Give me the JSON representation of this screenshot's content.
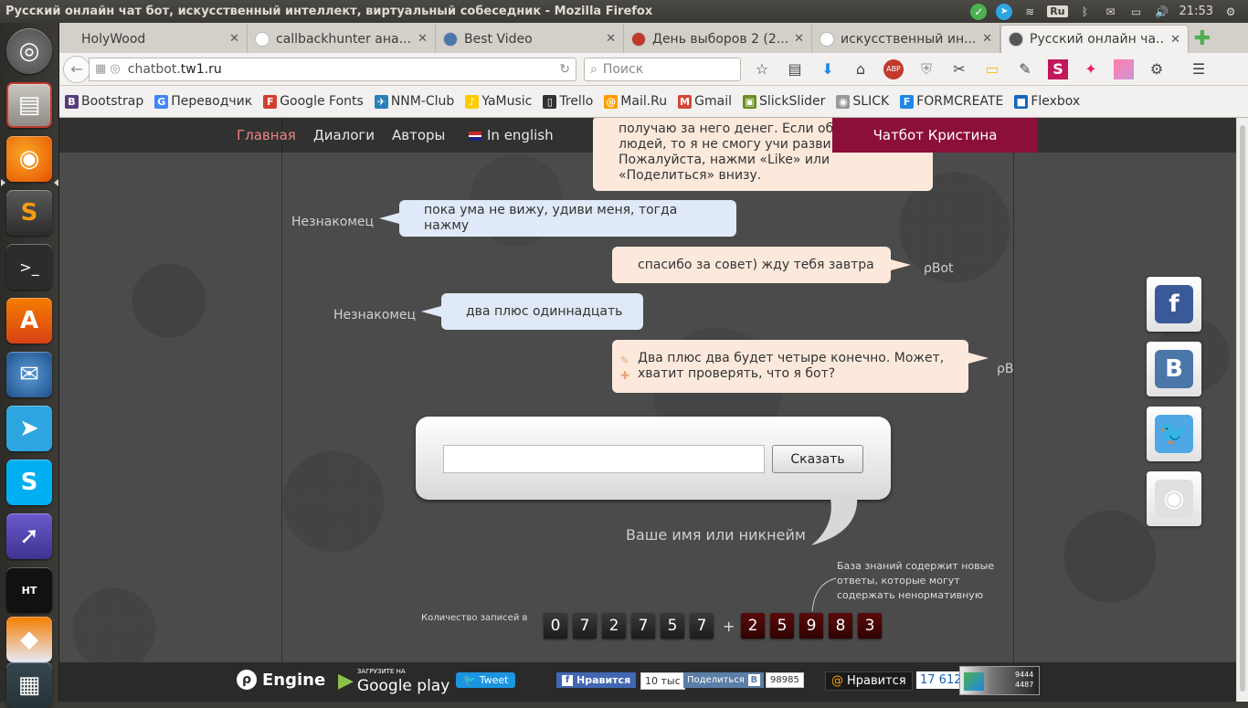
{
  "system": {
    "window_title": "Русский онлайн чат бот, искусственный интеллект, виртуальный собеседник - Mozilla Firefox",
    "keyboard_layout": "Ru",
    "clock": "21:53"
  },
  "browser": {
    "tabs": [
      {
        "label": "HolyWood",
        "favicon": "none",
        "color": "#d3d0ca"
      },
      {
        "label": "callbackhunter ана...",
        "favicon": "google-icon",
        "color": "#ffffff"
      },
      {
        "label": "Best Video",
        "favicon": "vk-icon",
        "color": "#4a76a8"
      },
      {
        "label": "День выборов 2 (2...",
        "favicon": "film-icon",
        "color": "#c0392b"
      },
      {
        "label": "искусственный ин...",
        "favicon": "google-icon",
        "color": "#ffffff"
      },
      {
        "label": "Русский онлайн ча...",
        "favicon": "chatbot-icon",
        "color": "#555555",
        "active": true
      }
    ],
    "url_prefix": "chatbot.",
    "url_host": "tw1.ru",
    "search_placeholder": "Поиск",
    "bookmarks": [
      {
        "label": "Bootstrap",
        "icon": "bootstrap-icon",
        "color": "#563d7c",
        "glyph": "B"
      },
      {
        "label": "Переводчик",
        "icon": "translate-icon",
        "color": "#4285f4",
        "glyph": "G"
      },
      {
        "label": "Google Fonts",
        "icon": "google-fonts-icon",
        "color": "#d23f31",
        "glyph": "F"
      },
      {
        "label": "NNM-Club",
        "icon": "nnm-icon",
        "color": "#2980b9",
        "glyph": "✈"
      },
      {
        "label": "YaMusic",
        "icon": "yamusic-icon",
        "color": "#ffcc00",
        "glyph": "♪"
      },
      {
        "label": "Trello",
        "icon": "trello-icon",
        "color": "#333333",
        "glyph": "▯"
      },
      {
        "label": "Mail.Ru",
        "icon": "mailru-icon",
        "color": "#ff9e00",
        "glyph": "@"
      },
      {
        "label": "Gmail",
        "icon": "gmail-icon",
        "color": "#d44638",
        "glyph": "M"
      },
      {
        "label": "SlickSlider",
        "icon": "slickslider-icon",
        "color": "#6b8e23",
        "glyph": "▣"
      },
      {
        "label": "SLICK",
        "icon": "slick-icon",
        "color": "#999999",
        "glyph": "◉"
      },
      {
        "label": "FORMCREATE",
        "icon": "formcreate-icon",
        "color": "#1e88e5",
        "glyph": "F"
      },
      {
        "label": "Flexbox",
        "icon": "flexbox-icon",
        "color": "#1565c0",
        "glyph": "■"
      }
    ]
  },
  "page": {
    "nav": {
      "home": "Главная",
      "dialogs": "Диалоги",
      "authors": "Авторы",
      "english": "In english",
      "chatbot_button": "Чатбот Кристина"
    },
    "messages": [
      {
        "from": "bot",
        "speaker": "",
        "text": "получаю за него денег. Если об узнает людей, то я не смогу учи развиваться. Пожалуйста, нажми «Like» или «Поделиться» внизу."
      },
      {
        "from": "user",
        "speaker": "Незнакомец",
        "text": "пока ума не вижу, удиви меня, тогда нажму"
      },
      {
        "from": "bot",
        "speaker": "ρBot",
        "text": "спасибо за совет) жду тебя завтра"
      },
      {
        "from": "user",
        "speaker": "Незнакомец",
        "text": "два плюс одиннадцать"
      },
      {
        "from": "bot",
        "speaker": "ρB",
        "text": "Два плюс два будет четыре конечно. Может, хватит проверять, что я бот?"
      }
    ],
    "input": {
      "value": "",
      "say_button": "Сказать",
      "nickname_hint": "Ваше имя или никнейм"
    },
    "knowledge_note": "База знаний содержит новые ответы, которые могут содержать ненормативную",
    "records_label": "Количество записей в",
    "record_digits": [
      "0",
      "7",
      "2",
      "7",
      "5",
      "7"
    ],
    "plus_sign": "+",
    "new_digits": [
      "2",
      "5",
      "9",
      "8",
      "3"
    ],
    "footer": {
      "engine": "Engine",
      "gplay_small": "ЗАГРУЗИТЕ НА",
      "gplay_big": "Google play",
      "tweet": "Tweet",
      "fb_like": "Нравится",
      "fb_count": "10 тыс",
      "vk_share": "Поделиться",
      "vk_count": "98985",
      "mailru_like": "Нравится",
      "mailru_count": "17 612",
      "counter_1": "9444",
      "counter_2": "4487"
    },
    "social_buttons": [
      {
        "name": "facebook",
        "glyph": "f",
        "color": "#3b5998"
      },
      {
        "name": "vkontakte",
        "glyph": "B",
        "color": "#4a76a8"
      },
      {
        "name": "twitter",
        "glyph": "🐦",
        "color": "#4fa7e6"
      },
      {
        "name": "chrome-webstore",
        "glyph": "◉",
        "color": "#e0e0e0"
      }
    ]
  }
}
